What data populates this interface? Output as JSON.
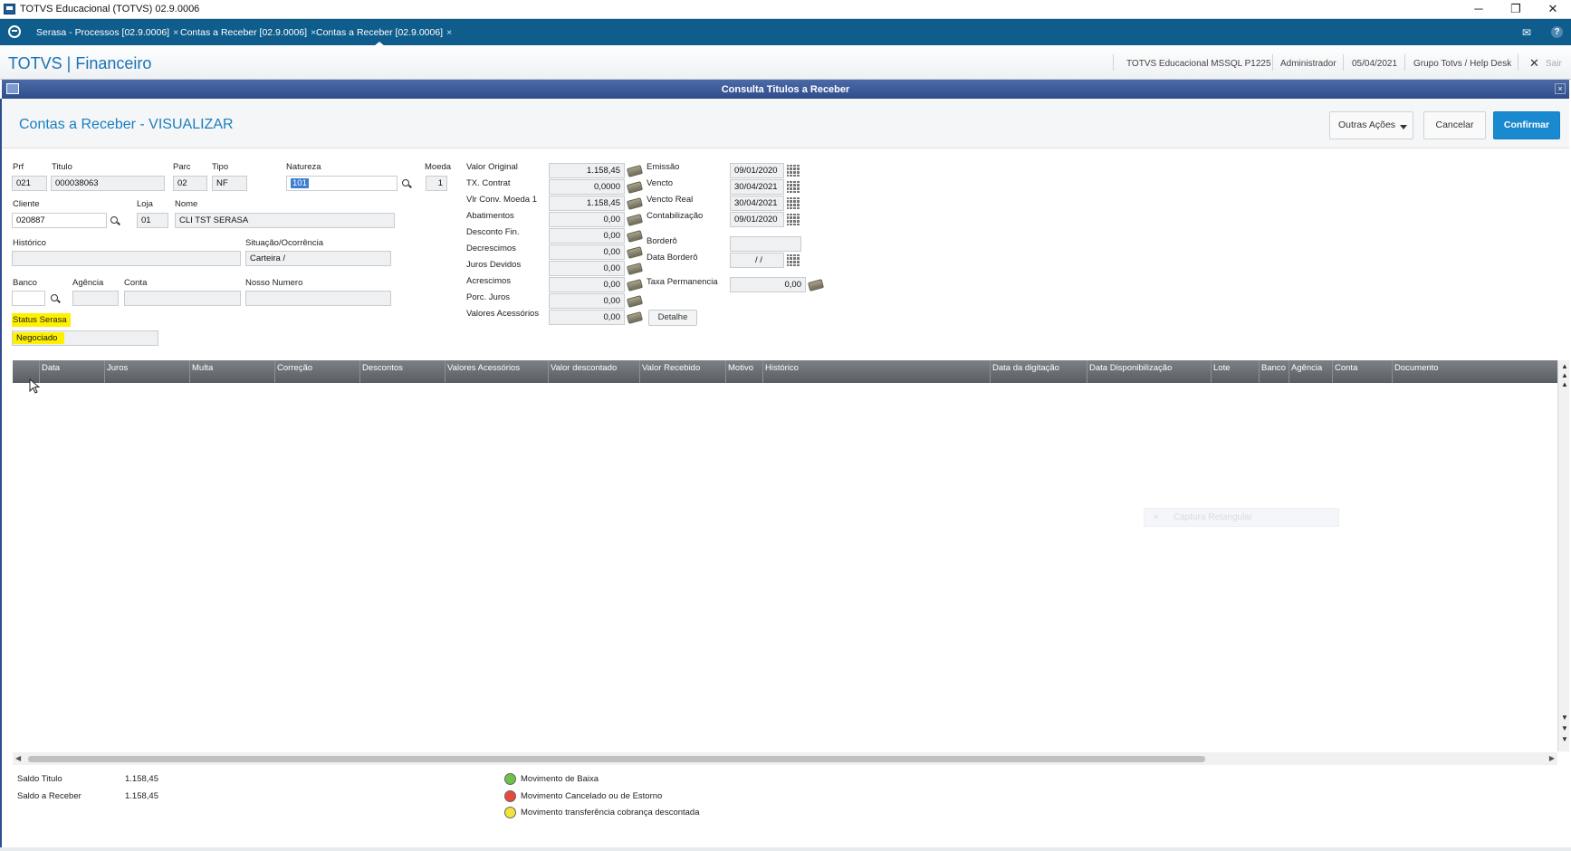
{
  "window": {
    "title": "TOTVS Educacional (TOTVS) 02.9.0006",
    "minimize": "─",
    "restore": "❐",
    "close": "✕"
  },
  "tabs": [
    {
      "label": "Serasa - Processos [02.9.0006]"
    },
    {
      "label": "Contas a Receber [02.9.0006]"
    },
    {
      "label": "Contas a Receber [02.9.0006]"
    }
  ],
  "tab_close": "×",
  "topbar_icons": {
    "mail": "✉",
    "help": "?"
  },
  "header": {
    "brand": "TOTVS | Financeiro",
    "environment": "TOTVS Educacional MSSQL P1225",
    "user": "Administrador",
    "date": "05/04/2021",
    "group": "Grupo Totvs / Help Desk",
    "exit": "Sair",
    "exit_icon": "✕"
  },
  "dialog": {
    "title": "Consulta Titulos a Receber",
    "close": "×"
  },
  "page": {
    "title": "Contas a Receber - VISUALIZAR",
    "buttons": {
      "other_actions": "Outras Ações",
      "cancel": "Cancelar",
      "confirm": "Confirmar"
    }
  },
  "form": {
    "prf": {
      "label": "Prf",
      "value": "021"
    },
    "titulo": {
      "label": "Titulo",
      "value": "000038063"
    },
    "parc": {
      "label": "Parc",
      "value": "02"
    },
    "tipo": {
      "label": "Tipo",
      "value": "NF"
    },
    "natureza": {
      "label": "Natureza",
      "value": "101"
    },
    "moeda": {
      "label": "Moeda",
      "value": "1"
    },
    "cliente": {
      "label": "Cliente",
      "value": "020887"
    },
    "loja": {
      "label": "Loja",
      "value": "01"
    },
    "nome": {
      "label": "Nome",
      "value": "CLI TST SERASA"
    },
    "historico": {
      "label": "Histórico",
      "value": ""
    },
    "situacao": {
      "label": "Situação/Ocorrência",
      "value": "Carteira /"
    },
    "banco": {
      "label": "Banco",
      "value": ""
    },
    "agencia": {
      "label": "Agência",
      "value": ""
    },
    "conta": {
      "label": "Conta",
      "value": ""
    },
    "nosso_numero": {
      "label": "Nosso Numero",
      "value": ""
    },
    "status_serasa": {
      "label": "Status Serasa",
      "value": "Negociado"
    }
  },
  "values": [
    {
      "label": "Valor Original",
      "value": "1.158,45"
    },
    {
      "label": "TX. Contrat",
      "value": "0,0000"
    },
    {
      "label": "Vlr Conv. Moeda 1",
      "value": "1.158,45"
    },
    {
      "label": "Abatimentos",
      "value": "0,00"
    },
    {
      "label": "Desconto Fin.",
      "value": "0,00"
    },
    {
      "label": "Decrescimos",
      "value": "0,00"
    },
    {
      "label": "Juros Devidos",
      "value": "0,00"
    },
    {
      "label": "Acrescimos",
      "value": "0,00"
    },
    {
      "label": "Porc. Juros",
      "value": "0,00"
    },
    {
      "label": "Valores Acessórios",
      "value": "0,00"
    }
  ],
  "detail_button": "Detalhe",
  "dates": {
    "emissao": {
      "label": "Emissão",
      "value": "09/01/2020"
    },
    "vencto": {
      "label": "Vencto",
      "value": "30/04/2021"
    },
    "vencto_real": {
      "label": "Vencto Real",
      "value": "30/04/2021"
    },
    "contabilizacao": {
      "label": "Contabilização",
      "value": "09/01/2020"
    },
    "bordero": {
      "label": "Borderô",
      "value": ""
    },
    "data_bordero": {
      "label": "Data Borderô",
      "value": "  /  /  "
    },
    "taxa_permanencia": {
      "label": "Taxa Permanencia",
      "value": "0,00"
    }
  },
  "grid": {
    "columns": [
      "Data",
      "Juros",
      "Multa",
      "Correção",
      "Descontos",
      "Valores Acessórios",
      "Valor descontado",
      "Valor Recebido",
      "Motivo",
      "Histórico",
      "Data da digitação",
      "Data Disponibilização",
      "Lote",
      "Banco",
      "Agência",
      "Conta",
      "Documento"
    ],
    "scroll_up": "▲",
    "scroll_down": "▼",
    "scroll_left": "◀",
    "scroll_right": "▶"
  },
  "footer": {
    "saldo_titulo": {
      "label": "Saldo Titulo",
      "value": "1.158,45"
    },
    "saldo_receber": {
      "label": "Saldo a Receber",
      "value": "1.158,45"
    },
    "legend": [
      {
        "label": "Movimento de Baixa",
        "color": "#6cc24a"
      },
      {
        "label": "Movimento Cancelado ou de Estorno",
        "color": "#e64a3c"
      },
      {
        "label": "Movimento transferência cobrança descontada",
        "color": "#f2e33a"
      }
    ]
  },
  "overlay": {
    "label": "Captura Retangular",
    "close": "×"
  }
}
